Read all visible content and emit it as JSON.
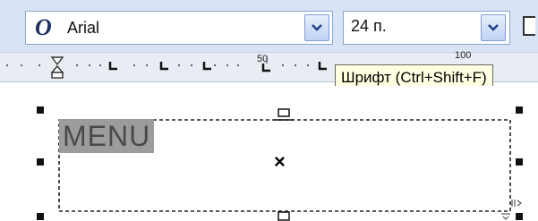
{
  "toolbar": {
    "font_icon": "opentype-font-icon",
    "font_glyph": "O",
    "font_name": "Arial",
    "font_size": "24 п.",
    "dropdown_icon": "chevron-down-icon"
  },
  "tooltip": {
    "text": "Шрифт (Ctrl+Shift+F)"
  },
  "ruler": {
    "labels": [
      "50",
      "100"
    ]
  },
  "canvas": {
    "text_frame_content": "MENU",
    "center_marker": "×"
  },
  "colors": {
    "toolbar_bg": "#d8e3f5",
    "combo_border": "#8aa6cf",
    "tooltip_bg": "#ffffe1",
    "selection_highlight": "#9c9c9c"
  }
}
